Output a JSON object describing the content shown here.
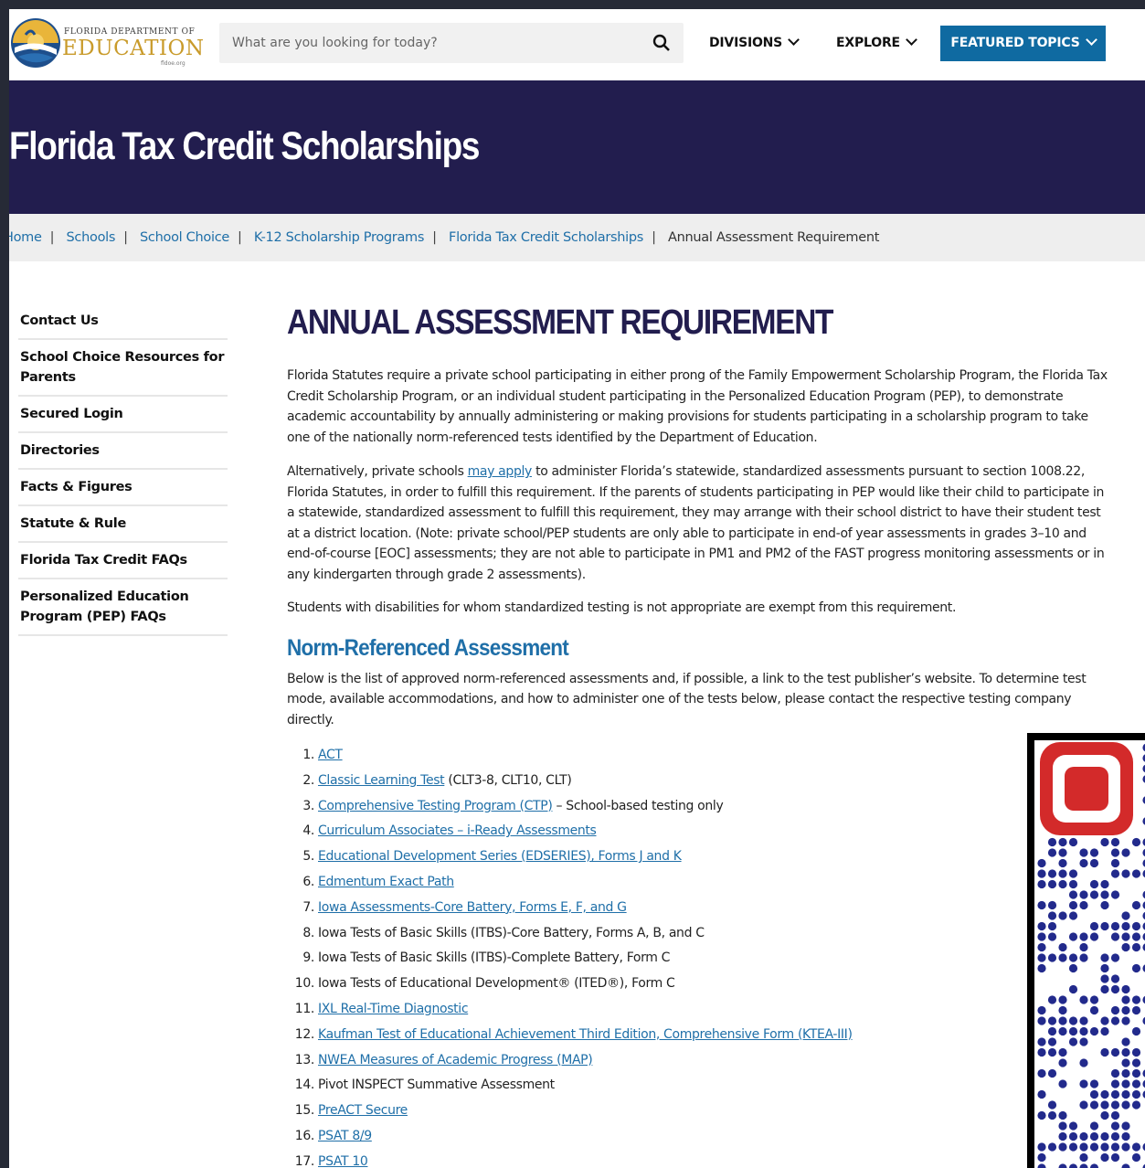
{
  "header": {
    "logo": {
      "line1": "FLORIDA DEPARTMENT OF",
      "line2": "EDUCATION",
      "line3": "fldoe.org"
    },
    "search": {
      "placeholder": "What are you looking for today?"
    },
    "nav": {
      "divisions": "DIVISIONS",
      "explore": "EXPLORE",
      "featured": "FEATURED TOPICS"
    }
  },
  "hero": {
    "title": "Florida Tax Credit Scholarships"
  },
  "breadcrumb": {
    "items": [
      "Home",
      "Schools",
      "School Choice",
      "K-12 Scholarship Programs",
      "Florida Tax Credit Scholarships"
    ],
    "current": "Annual Assessment Requirement",
    "separator": "|"
  },
  "sidebar": {
    "items": [
      "Contact Us",
      "School Choice Resources for Parents",
      "Secured Login",
      "Directories",
      "Facts & Figures",
      "Statute & Rule",
      "Florida Tax Credit FAQs",
      "Personalized Education Program (PEP) FAQs"
    ]
  },
  "main": {
    "heading": "ANNUAL ASSESSMENT REQUIREMENT",
    "p1": "Florida Statutes require a private school participating in either prong of the Family Empowerment Scholarship Program, the Florida Tax Credit Scholarship Program, or an individual student participating in the Personalized Education Program (PEP), to demonstrate academic accountability by annually administering or making provisions for students participating in a scholarship program to take one of the nationally norm-referenced tests identified by the Department of Education.",
    "p2_before": "Alternatively, private schools ",
    "p2_link": "may apply",
    "p2_after": " to administer Florida’s statewide, standardized assessments pursuant to section 1008.22, Florida Statutes, in order to fulfill this requirement. If the parents of students participating in PEP would like their child to participate in a statewide, standardized assessment to fulfill this requirement, they may arrange with their school district to have their student test at a district location. (Note: private school/PEP students are only able to participate in end-of year assessments in grades 3–10 and end-of-course [EOC] assessments; they are not able to participate in PM1 and PM2 of the FAST progress monitoring assessments or in any kindergarten through grade 2 assessments).",
    "p3": "Students with disabilities for whom standardized testing is not appropriate are exempt from this requirement.",
    "subheading": "Norm-Referenced Assessment",
    "p4": "Below is the list of approved norm-referenced assessments and, if possible, a link to the test publisher’s website. To determine test mode, available accommodations, and how to administer one of the tests below, please contact the respective testing company directly.",
    "tests": [
      {
        "num": "1.",
        "link": "ACT",
        "text": ""
      },
      {
        "num": "2.",
        "link": "Classic Learning Test",
        "text": " (CLT3-8, CLT10, CLT)"
      },
      {
        "num": "3.",
        "link": "Comprehensive Testing Program (CTP)",
        "text": " – School-based testing only"
      },
      {
        "num": "4.",
        "link": "Curriculum Associates – i-Ready Assessments",
        "text": ""
      },
      {
        "num": "5.",
        "link": "Educational Development Series (EDSERIES), Forms J and K",
        "text": ""
      },
      {
        "num": "6.",
        "link": "Edmentum Exact Path",
        "text": ""
      },
      {
        "num": "7.",
        "link": "Iowa Assessments-Core Battery, Forms E, F, and G",
        "text": ""
      },
      {
        "num": "8.",
        "link": "",
        "text": "Iowa Tests of Basic Skills (ITBS)-Core Battery, Forms A, B, and C"
      },
      {
        "num": "9.",
        "link": "",
        "text": "Iowa Tests of Basic Skills (ITBS)-Complete Battery, Form C"
      },
      {
        "num": "10.",
        "link": "",
        "text": "Iowa Tests of Educational Development® (ITED®), Form C"
      },
      {
        "num": "11.",
        "link": "IXL Real-Time Diagnostic",
        "text": ""
      },
      {
        "num": "12.",
        "link": "Kaufman Test of Educational Achievement Third Edition, Comprehensive Form (KTEA-III)",
        "text": ""
      },
      {
        "num": "13.",
        "link": "NWEA Measures of Academic Progress (MAP)",
        "text": ""
      },
      {
        "num": "14.",
        "link": "",
        "text": "Pivot INSPECT Summative Assessment"
      },
      {
        "num": "15.",
        "link": "PreACT Secure",
        "text": ""
      },
      {
        "num": "16.",
        "link": "PSAT 8/9",
        "text": ""
      },
      {
        "num": "17.",
        "link": "PSAT 10",
        "text": ""
      }
    ]
  },
  "colors": {
    "hero_bg": "#221d4e",
    "link": "#1f6fa8",
    "featured_button": "#0f6aa1",
    "qr_dots": "#222a8c",
    "qr_logo": "#d32a2a"
  }
}
